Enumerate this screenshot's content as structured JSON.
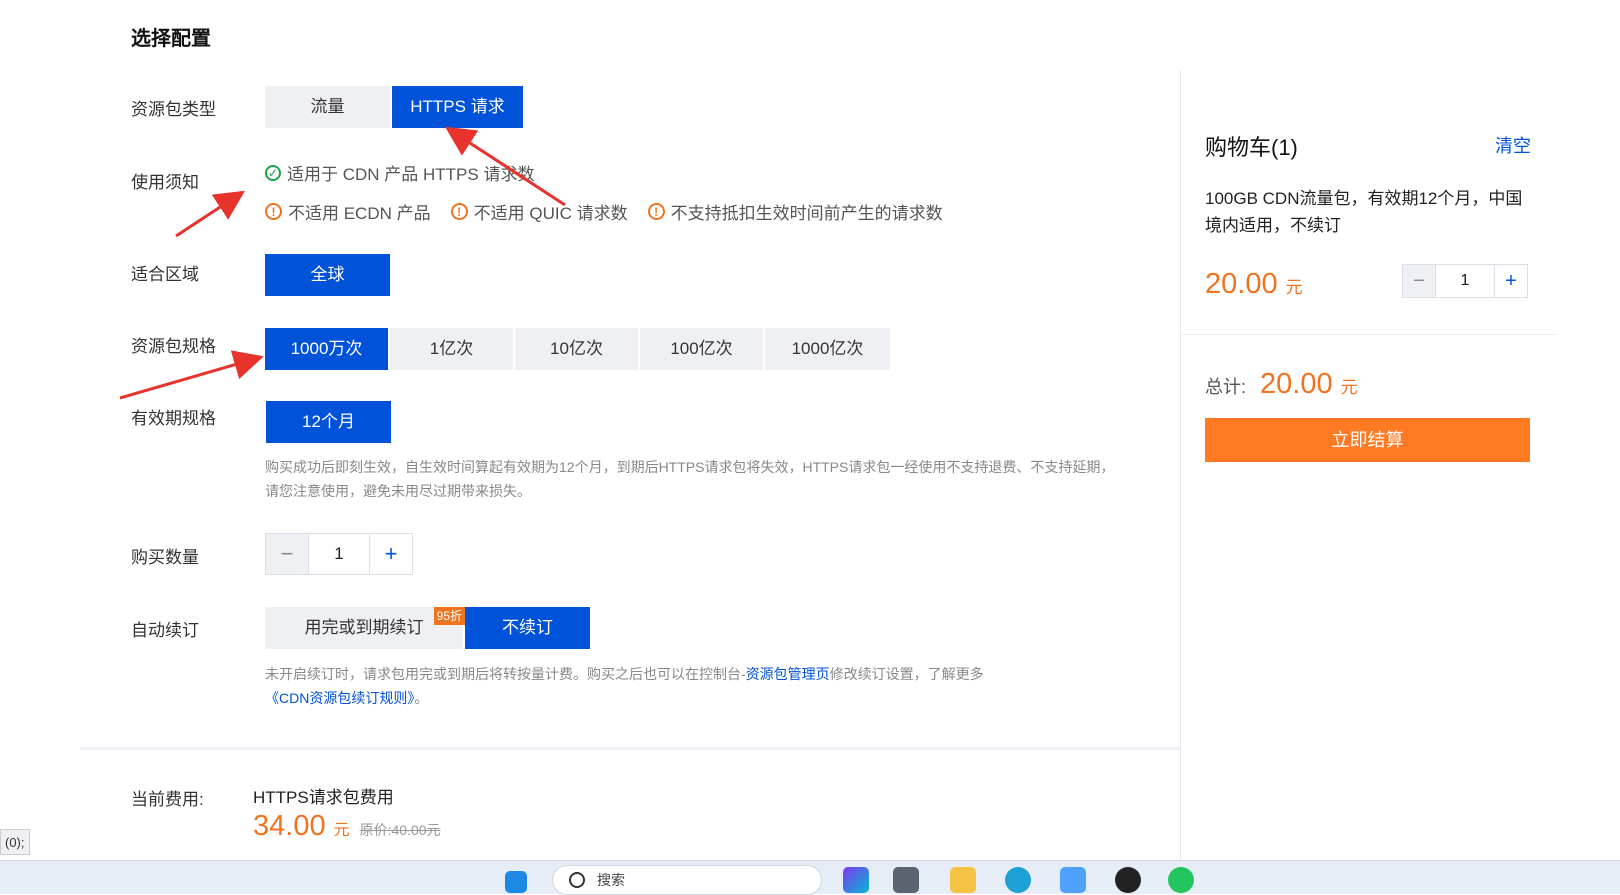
{
  "section_title": "选择配置",
  "rows": {
    "type_label": "资源包类型",
    "notice_label": "使用须知",
    "region_label": "适合区域",
    "spec_label": "资源包规格",
    "validity_label": "有效期规格",
    "qty_label": "购买数量",
    "renew_label": "自动续订"
  },
  "type_options": [
    "流量",
    "HTTPS 请求"
  ],
  "notices": {
    "ok": "适用于 CDN 产品 HTTPS 请求数",
    "warn1": "不适用 ECDN 产品",
    "warn2": "不适用 QUIC 请求数",
    "warn3": "不支持抵扣生效时间前产生的请求数"
  },
  "region_option": "全球",
  "spec_options": [
    "1000万次",
    "1亿次",
    "10亿次",
    "100亿次",
    "1000亿次"
  ],
  "validity_option": "12个月",
  "validity_hint": "购买成功后即刻生效，自生效时间算起有效期为12个月，到期后HTTPS请求包将失效，HTTPS请求包一经使用不支持退费、不支持延期，请您注意使用，避免未用尽过期带来损失。",
  "qty": {
    "minus": "−",
    "value": "1",
    "plus": "+"
  },
  "renew": {
    "option1": "用完或到期续订",
    "badge": "95折",
    "option2": "不续订",
    "hint_pre": "未开启续订时，请求包用完或到期后将转按量计费。购买之后也可以在控制台-",
    "hint_link1": "资源包管理页",
    "hint_mid": "修改续订设置，了解更多",
    "hint_link2": "《CDN资源包续订规则》",
    "hint_end": "。"
  },
  "current_fee": {
    "label": "当前费用:",
    "item": "HTTPS请求包费用",
    "price": "34.00",
    "unit": "元",
    "original": "原价:40.00元"
  },
  "cart": {
    "title": "购物车(1)",
    "clear": "清空",
    "desc": "100GB CDN流量包，有效期12个月，中国境内适用，不续订",
    "price": "20.00",
    "unit": "元",
    "qty_minus": "−",
    "qty_value": "1",
    "qty_plus": "+",
    "total_label": "总计:",
    "total_price": "20.00",
    "total_unit": "元",
    "checkout": "立即结算"
  },
  "status_tip": "(0);",
  "taskbar": {
    "search_text": "搜索"
  },
  "colors": {
    "primary": "#0052d9",
    "accent": "#f07320",
    "annotation": "#e8322c"
  }
}
